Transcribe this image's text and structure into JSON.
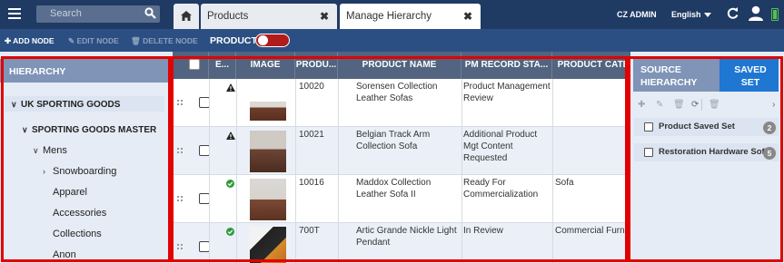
{
  "topbar": {
    "search_placeholder": "Search",
    "tabs": [
      {
        "label": "Products",
        "close": "✖"
      },
      {
        "label": "Manage Hierarchy",
        "close": "✖"
      }
    ],
    "user": "CZ ADMIN",
    "language": "English",
    "icons": [
      "menu-icon",
      "search-icon",
      "home-icon",
      "refresh-icon",
      "user-icon",
      "battery-icon"
    ]
  },
  "actions": {
    "add_node": "ADD NODE",
    "edit_node": "EDIT NODE",
    "delete_node": "DELETE NODE",
    "product_toggle_label": "PRODUCT",
    "product_toggle_on": false,
    "toggle_color": "#b11b1b"
  },
  "hierarchy": {
    "title": "HIERARCHY",
    "tree": [
      {
        "label": "UK SPORTING GOODS",
        "expanded": true
      },
      {
        "label": "SPORTING GOODS MASTER",
        "expanded": true
      },
      {
        "label": "Mens",
        "expanded": true
      },
      {
        "label": "Snowboarding",
        "expanded": false
      },
      {
        "label": "Apparel"
      },
      {
        "label": "Accessories"
      },
      {
        "label": "Collections"
      },
      {
        "label": "Anon"
      }
    ]
  },
  "grid": {
    "columns": [
      "",
      "E...",
      "IMAGE",
      "PRODU...",
      "PRODUCT NAME",
      "PM RECORD STA...",
      "PRODUCT CATE"
    ],
    "rows": [
      {
        "status": "warning",
        "product_id": "10020",
        "name": "Sorensen Collection Leather Sofas",
        "pm_status": "Product Management Review",
        "category": ""
      },
      {
        "status": "warning",
        "product_id": "10021",
        "name": "Belgian Track Arm Collection Sofa",
        "pm_status": "Additional Product Mgt Content Requested",
        "category": ""
      },
      {
        "status": "ok",
        "product_id": "10016",
        "name": "Maddox Collection Leather Sofa II",
        "pm_status": "Ready For Commercialization",
        "category": "Sofa"
      },
      {
        "status": "ok",
        "product_id": "700T",
        "name": "Artic Grande Nickle Light Pendant",
        "pm_status": "In Review",
        "category": "Commercial Furnitu"
      }
    ],
    "status_colors": {
      "warning": "#222222",
      "ok": "#2e9b3a"
    }
  },
  "source_panel": {
    "source_hierarchy_label": "SOURCE HIERARCHY",
    "saved_set_label": "SAVED SET",
    "saved_sets": [
      {
        "label": "Product Saved Set",
        "count": "2"
      },
      {
        "label": "Restoration Hardware Sofas",
        "count": "5"
      }
    ]
  },
  "colors": {
    "topbar": "#1f3a63",
    "actionbar": "#2c4f83",
    "header": "#52647f",
    "accent": "#1f77d1",
    "highlight": "#e20000"
  }
}
